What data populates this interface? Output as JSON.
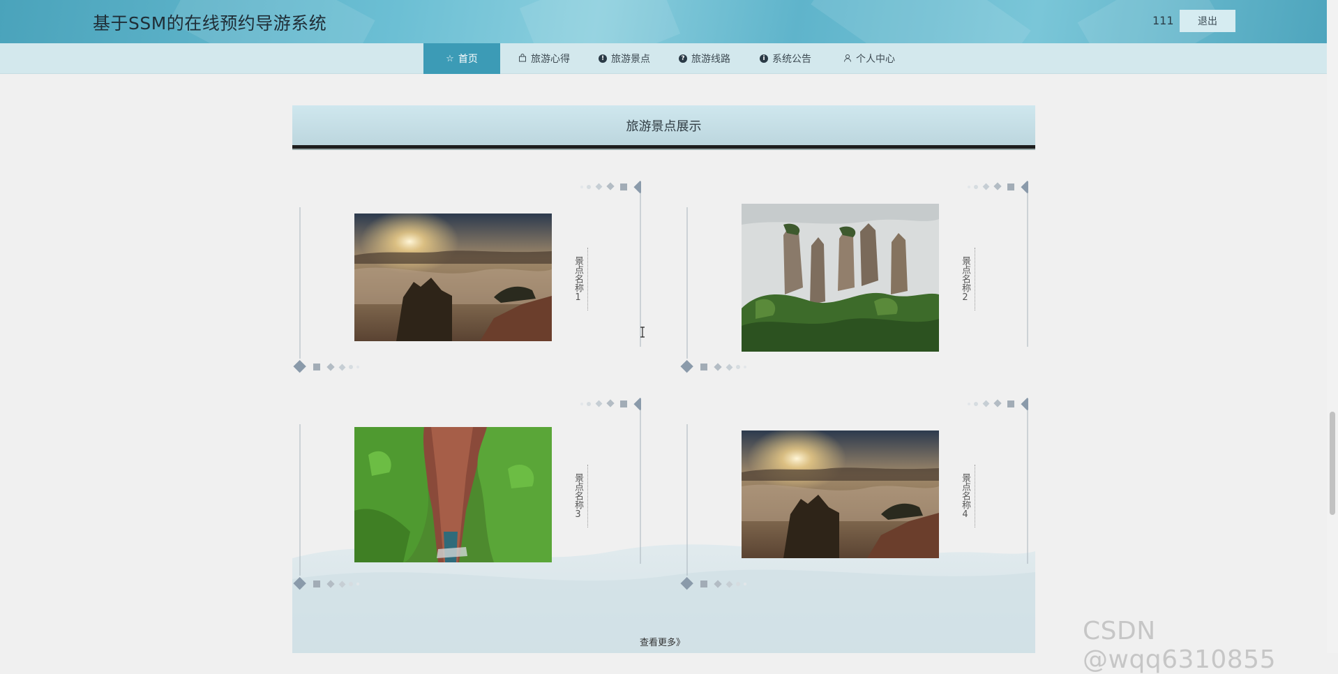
{
  "header": {
    "site_title": "基于SSM的在线预约导游系统",
    "username": "111",
    "logout_label": "退出"
  },
  "nav": {
    "items": [
      {
        "label": "首页",
        "icon": "star-icon",
        "active": true
      },
      {
        "label": "旅游心得",
        "icon": "bag-icon",
        "active": false
      },
      {
        "label": "旅游景点",
        "icon": "exclamation-circle-icon",
        "active": false
      },
      {
        "label": "旅游线路",
        "icon": "question-circle-icon",
        "active": false
      },
      {
        "label": "系统公告",
        "icon": "info-circle-icon",
        "active": false
      },
      {
        "label": "个人中心",
        "icon": "user-icon",
        "active": false
      }
    ]
  },
  "section": {
    "title": "旅游景点展示",
    "more_label": "查看更多》"
  },
  "spots": [
    {
      "name": "景点名称1",
      "image": "sunrise-sea-of-clouds-photo"
    },
    {
      "name": "景点名称2",
      "image": "misty-stone-pillars-photo"
    },
    {
      "name": "景点名称3",
      "image": "red-rock-canyon-photo"
    },
    {
      "name": "景点名称4",
      "image": "sunrise-sea-of-clouds-photo"
    }
  ],
  "watermark": "CSDN @wqq6310855",
  "colors": {
    "header_bg": "#5fb4cb",
    "nav_bg": "#d3e8ed",
    "nav_active": "#3c9bb6",
    "page_bg": "#f0f0f0"
  }
}
